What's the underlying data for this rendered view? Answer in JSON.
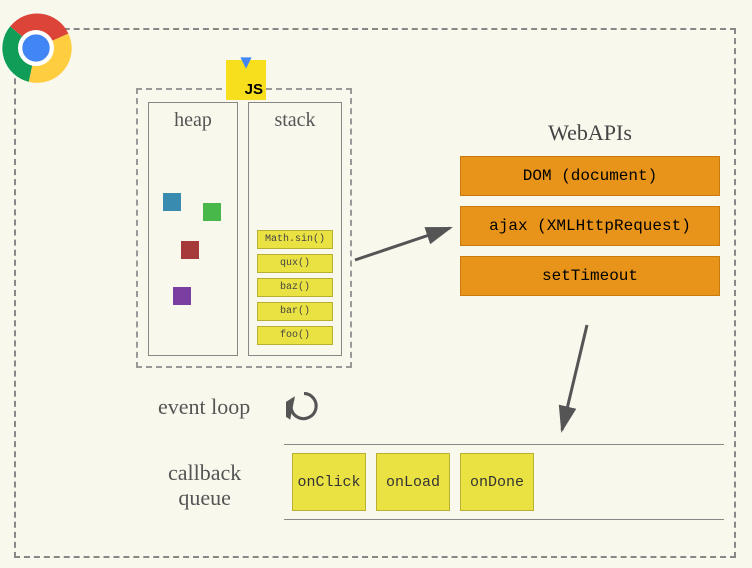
{
  "js_badge": "JS",
  "heap": {
    "label": "heap"
  },
  "stack": {
    "label": "stack",
    "items": [
      "Math.sin()",
      "qux()",
      "baz()",
      "bar()",
      "foo()"
    ]
  },
  "webapis": {
    "title": "WebAPIs",
    "items": [
      "DOM (document)",
      "ajax (XMLHttpRequest)",
      "setTimeout"
    ]
  },
  "event_loop_label": "event loop",
  "callback_queue": {
    "label": "callback\nqueue",
    "items": [
      "onClick",
      "onLoad",
      "onDone"
    ]
  },
  "colors": {
    "heap_squares": [
      "#3a8bb0",
      "#49b84a",
      "#a63a3a",
      "#7a3fa0"
    ],
    "stack_bg": "#eae243",
    "webapi_bg": "#e8941a"
  }
}
